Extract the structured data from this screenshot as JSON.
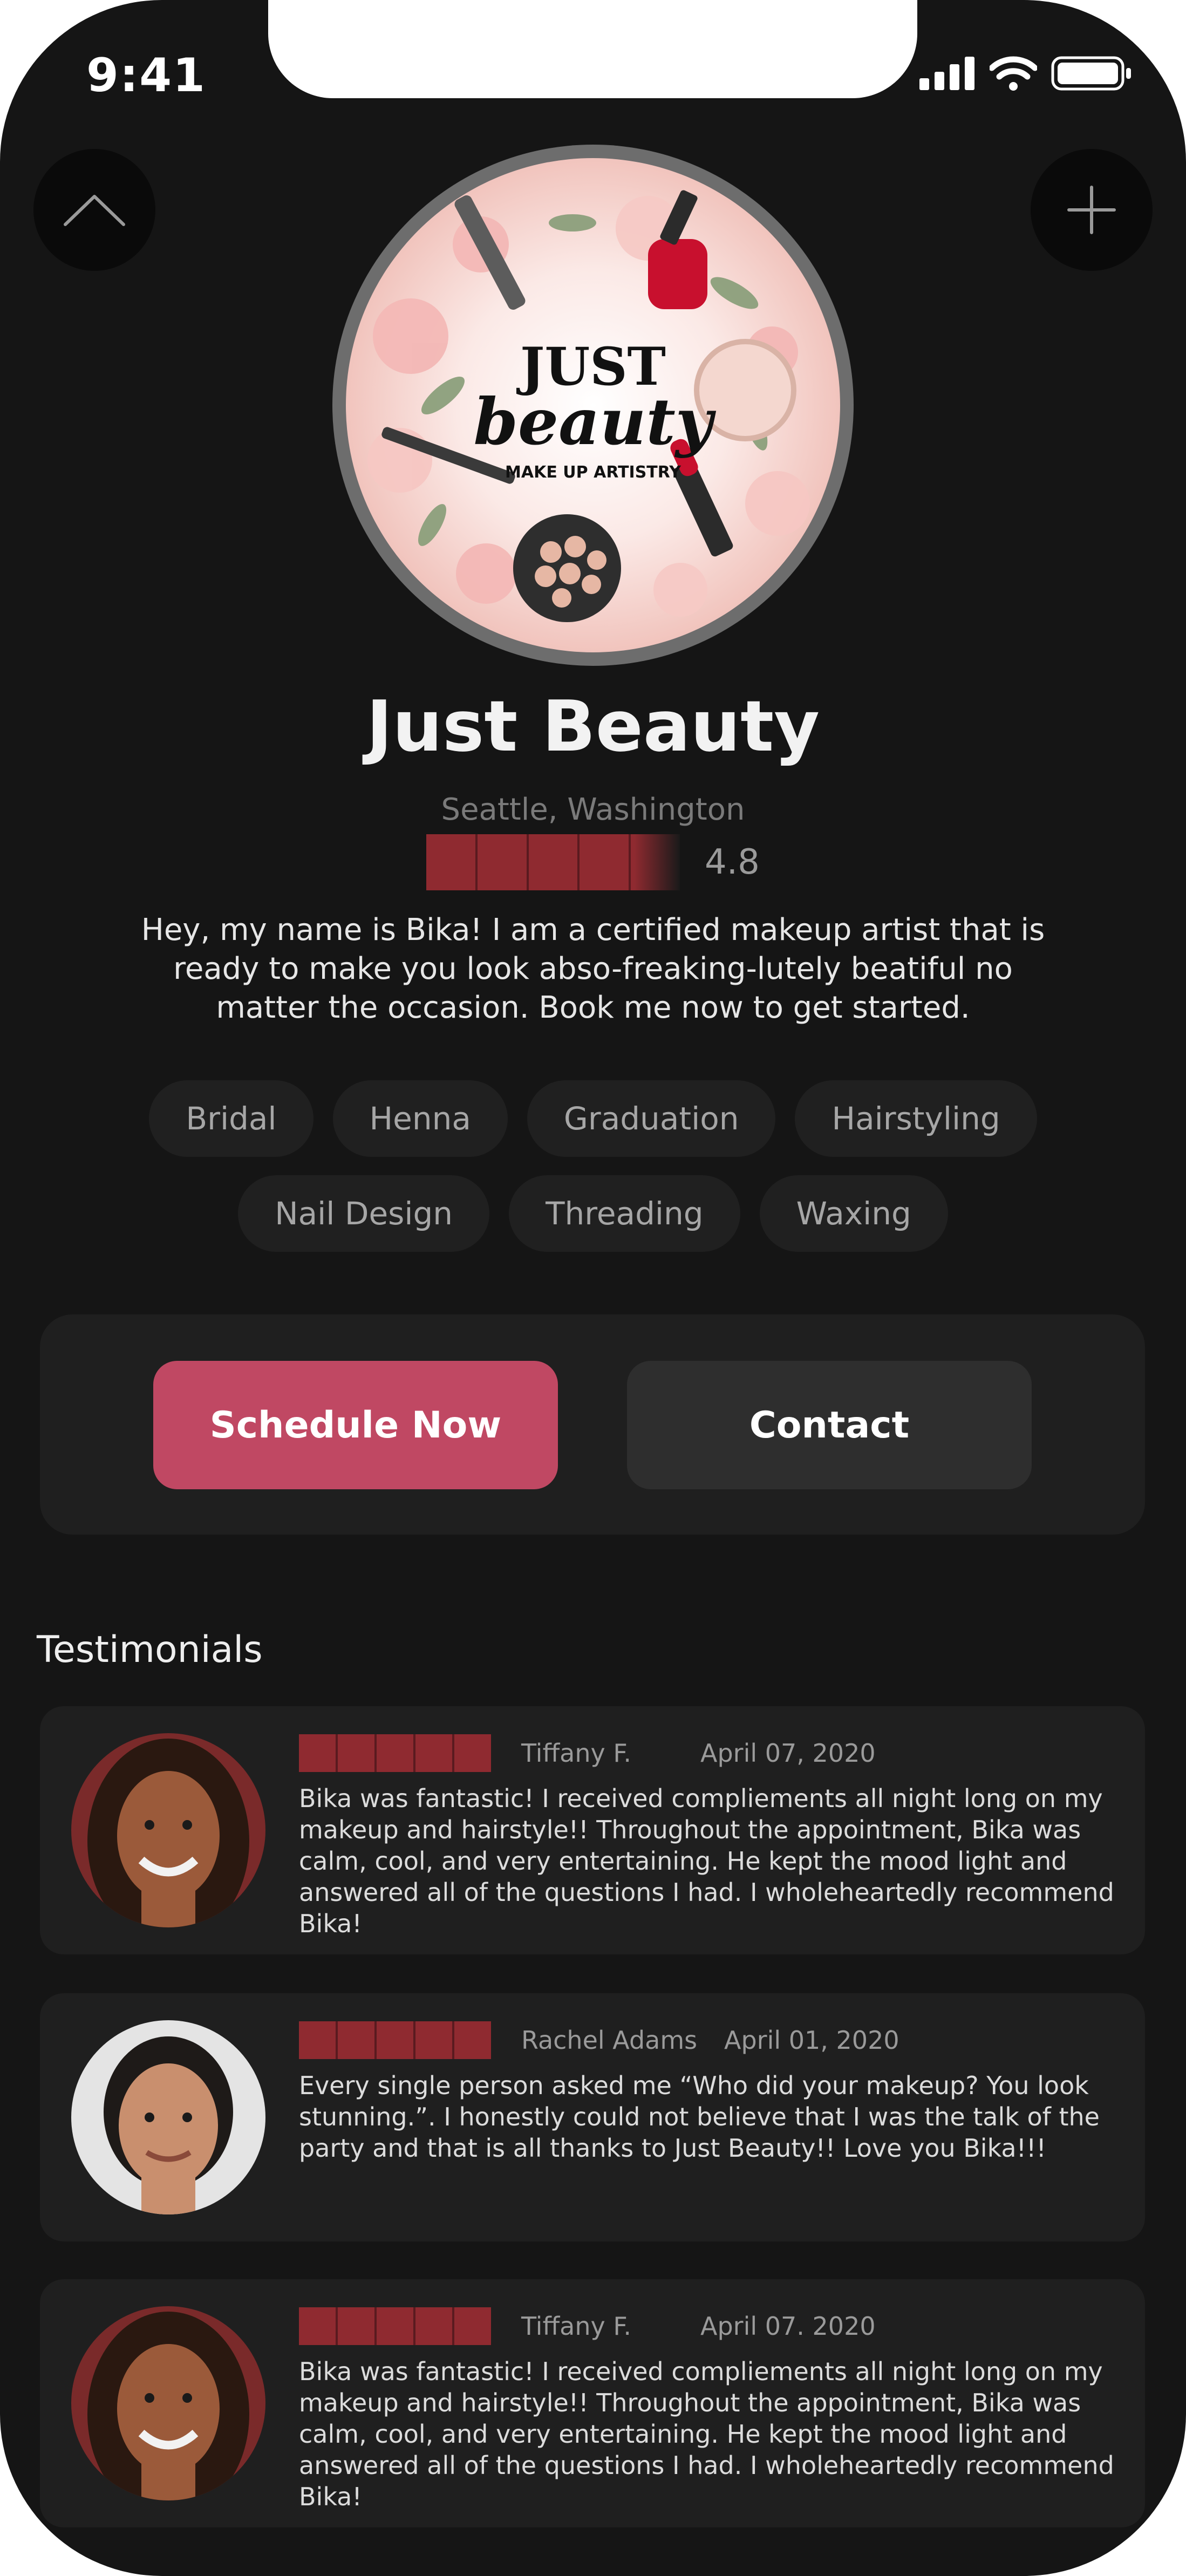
{
  "status_bar": {
    "time": "9:41"
  },
  "header": {
    "up_icon": "chevron-up-icon",
    "add_icon": "plus-icon"
  },
  "logo": {
    "line1": "JUST",
    "line2": "beauty",
    "line3": "MAKE UP ARTISTRY"
  },
  "profile": {
    "name": "Just Beauty",
    "location": "Seattle, Washington",
    "rating": "4.8",
    "bio": "Hey, my name is Bika! I am a certified makeup artist that is ready to make you look abso-freaking-lutely beatiful no matter the occasion. Book me now to get started."
  },
  "services": [
    "Bridal",
    "Henna",
    "Graduation",
    "Hairstyling",
    "Nail Design",
    "Threading",
    "Waxing"
  ],
  "actions": {
    "schedule": "Schedule Now",
    "contact": "Contact"
  },
  "testimonials": {
    "heading": "Testimonials",
    "items": [
      {
        "name": "Tiffany F.",
        "date": "April 07, 2020",
        "text": "Bika was fantastic! I received compliements all night long on my makeup and hairstyle!! Throughout the appointment, Bika was calm, cool, and very entertaining. He kept the mood light and answered all of the questions I had. I wholeheartedly recommend Bika!"
      },
      {
        "name": "Rachel Adams",
        "date": "April 01, 2020",
        "text": "Every single person asked me “Who did your makeup? You look stunning.”. I honestly could not believe that I was the talk of the party and that is all thanks to Just Beauty!! Love you Bika!!!"
      },
      {
        "name": "Tiffany F.",
        "date": "April 07. 2020",
        "text": "Bika was fantastic! I received compliements all night long on my makeup and hairstyle!! Throughout the appointment, Bika was calm, cool, and very entertaining. He kept the mood light and answered all of the questions I had. I wholeheartedly recommend Bika!"
      }
    ]
  },
  "colors": {
    "background": "#151515",
    "card": "#1f1f1f",
    "accent": "#c04863",
    "stars": "#8f2a30"
  }
}
